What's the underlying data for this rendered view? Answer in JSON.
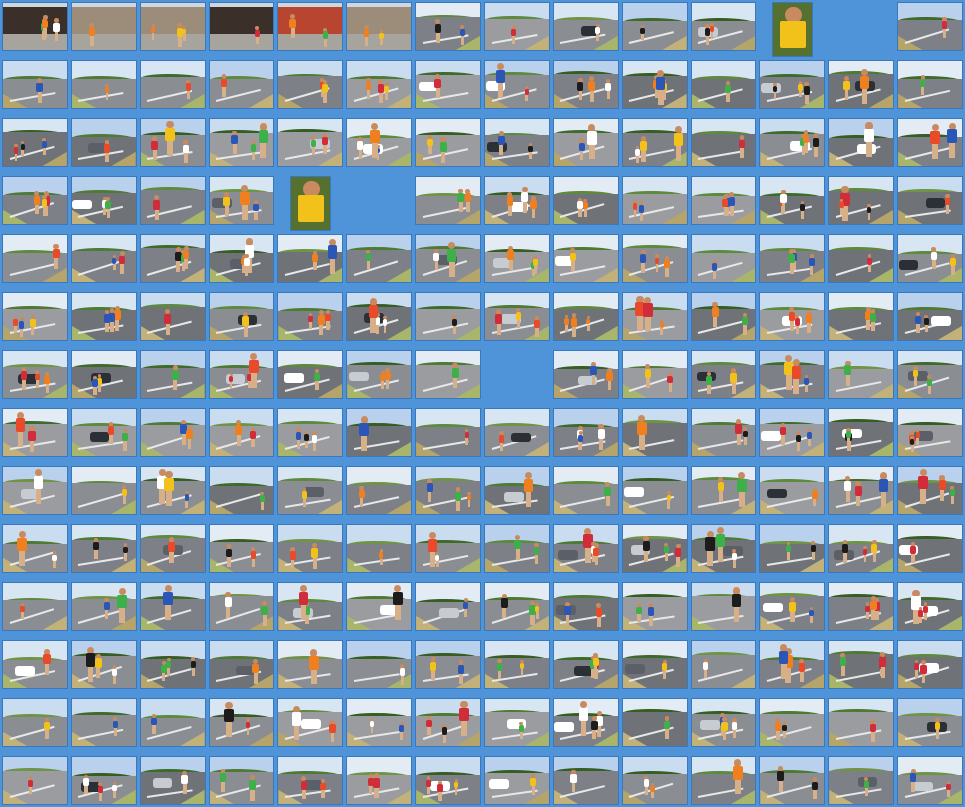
{
  "sheet": {
    "rows": 14,
    "cols": 14,
    "background": "#4f93d8",
    "frame_color": "#3a78bd"
  },
  "palette": {
    "sky": [
      "#c9dcf0",
      "#d8e6f3",
      "#b9d1ec",
      "#e3ecf5"
    ],
    "trees": [
      "#3f6b2a",
      "#4e7a34",
      "#5d8a3c",
      "#365e22",
      "#6f9446"
    ],
    "road": [
      "#8a8d92",
      "#7d8187",
      "#9a9ca0",
      "#6f7378"
    ],
    "verge": [
      "#b6a56a",
      "#a8b56a",
      "#c2b27a"
    ],
    "shirts": [
      "#f2c21b",
      "#e84a2a",
      "#ffffff",
      "#2a56b8",
      "#f07f1f",
      "#d02c3a",
      "#1c1c1c",
      "#3db04a"
    ],
    "cars": [
      "#2b2f36",
      "#c7ccd3",
      "#ffffff",
      "#5b6068"
    ]
  },
  "special_cells": {
    "row0_urban": [
      0,
      1,
      2,
      3
    ],
    "row0_building": [
      4
    ],
    "row0_street": [
      5
    ],
    "empty": [
      "0-12",
      "3-5",
      "6-7"
    ],
    "portrait": [
      "0-11",
      "3-4"
    ]
  }
}
